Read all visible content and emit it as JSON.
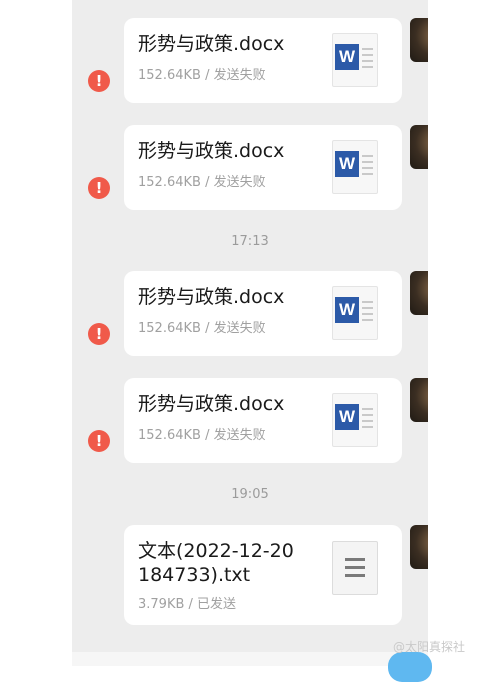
{
  "messages": [
    {
      "file_name": "形势与政策.docx",
      "meta": "152.64KB / 发送失败",
      "icon": "word-doc-icon",
      "status": "failed"
    },
    {
      "file_name": "形势与政策.docx",
      "meta": "152.64KB / 发送失败",
      "icon": "word-doc-icon",
      "status": "failed"
    },
    {
      "file_name": "形势与政策.docx",
      "meta": "152.64KB / 发送失败",
      "icon": "word-doc-icon",
      "status": "failed"
    },
    {
      "file_name": "形势与政策.docx",
      "meta": "152.64KB / 发送失败",
      "icon": "word-doc-icon",
      "status": "failed"
    },
    {
      "file_name": "文本(2022-12-20 184733).txt",
      "meta": "3.79KB / 已发送",
      "icon": "text-file-icon",
      "status": "sent"
    }
  ],
  "timestamps": [
    "17:13",
    "19:05"
  ],
  "error_glyph": "!",
  "word_glyph": "W",
  "watermark": "@太阳真探社",
  "colors": {
    "chat_bg": "#ededed",
    "error": "#f05a4a",
    "word_blue": "#2c5aa8",
    "send_button": "#5fb8f0"
  }
}
